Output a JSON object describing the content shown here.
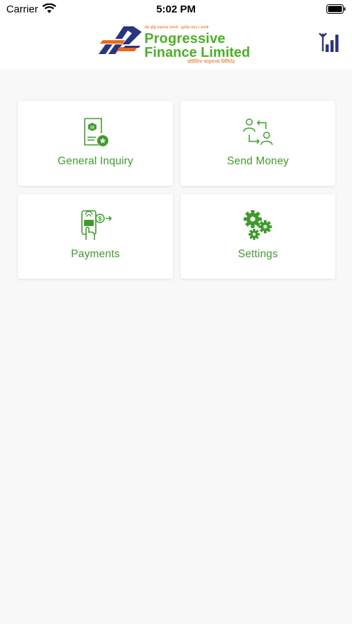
{
  "status_bar": {
    "carrier": "Carrier",
    "time": "5:02 PM"
  },
  "header": {
    "logo": {
      "tagline": "तीव्र वृद्धि फाइनान्स कम्पनी · सुरक्षित बचत र लगानी",
      "name_line1": "Progressive",
      "name_line2": "Finance Limited",
      "name_nepali": "प्रोग्रेसिभ फाइनान्स लिमिटेड"
    },
    "signal_icon": "signal-bars-icon"
  },
  "menu": [
    {
      "label": "General Inquiry",
      "icon": "document-badge-icon"
    },
    {
      "label": "Send Money",
      "icon": "transfer-users-icon"
    },
    {
      "label": "Payments",
      "icon": "mobile-payment-icon"
    },
    {
      "label": "Settings",
      "icon": "gears-icon"
    }
  ],
  "colors": {
    "accent": "#3f9b2b",
    "brand_green": "#4caf26",
    "brand_orange": "#e8691e",
    "brand_navy": "#2a3580"
  }
}
